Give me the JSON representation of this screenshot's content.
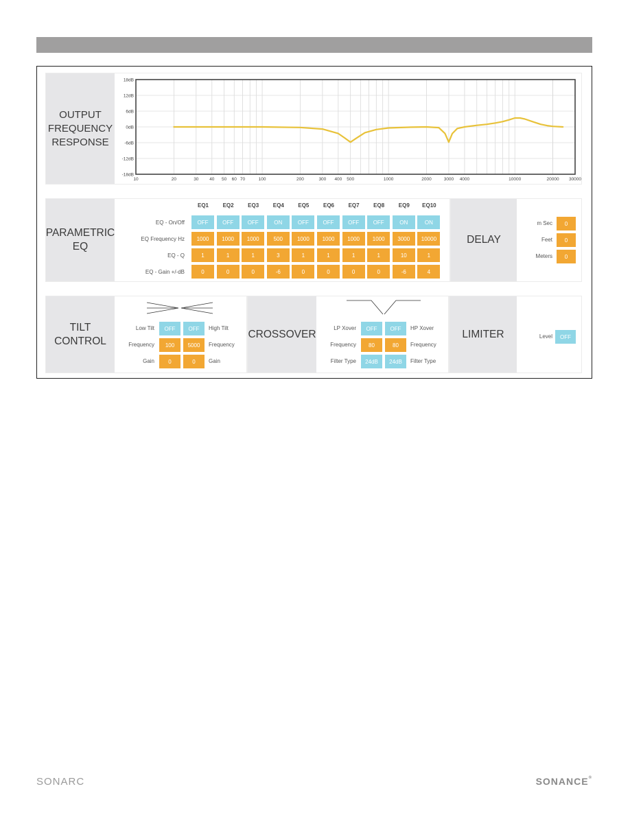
{
  "footer": {
    "left_logo": "SONARC",
    "right_logo": "SONANCE",
    "right_mark": "®"
  },
  "chart": {
    "label": [
      "OUTPUT",
      "FREQUENCY",
      "RESPONSE"
    ]
  },
  "chart_data": {
    "type": "line",
    "title": "Output Frequency Response",
    "xscale": "log",
    "xlim": [
      10,
      30000
    ],
    "ylim": [
      -18,
      18
    ],
    "x_ticks": [
      10,
      20,
      30,
      40,
      50,
      60,
      70,
      100,
      200,
      300,
      400,
      500,
      1000,
      2000,
      3000,
      4000,
      10000,
      20000,
      30000
    ],
    "x_tick_labels": [
      "10",
      "20",
      "30",
      "40",
      "50",
      "60",
      "70",
      "100",
      "200",
      "300",
      "400",
      "500",
      "1000",
      "2000",
      "3000",
      "4000",
      "10000",
      "20000",
      "30000"
    ],
    "y_ticks": [
      18,
      12,
      6,
      0,
      -6,
      -12,
      -18
    ],
    "y_tick_labels": [
      "18dB",
      "12dB",
      "6dB",
      "0dB",
      "-6dB",
      "-12dB",
      "-18dB"
    ],
    "grid": true,
    "series": [
      {
        "name": "response",
        "color": "#e8c23a",
        "x": [
          20,
          50,
          100,
          200,
          300,
          400,
          450,
          500,
          560,
          650,
          800,
          1000,
          1500,
          2000,
          2500,
          2800,
          3000,
          3200,
          3500,
          4000,
          5000,
          6000,
          7000,
          8000,
          9000,
          10000,
          11000,
          12000,
          14000,
          16000,
          18000,
          20000,
          24000
        ],
        "y": [
          0,
          0,
          0,
          -0.2,
          -0.8,
          -2.5,
          -4.2,
          -5.8,
          -4.2,
          -2.2,
          -1.0,
          -0.4,
          -0.1,
          0,
          -0.3,
          -2.5,
          -5.8,
          -2.5,
          -0.6,
          0,
          0.6,
          1.0,
          1.5,
          2.0,
          2.7,
          3.4,
          3.4,
          3.0,
          1.9,
          1.0,
          0.5,
          0.2,
          0
        ]
      }
    ]
  },
  "eq": {
    "label": [
      "PARAMETRIC",
      "EQ"
    ],
    "row_labels": [
      "EQ - On/Off",
      "EQ Frequency Hz",
      "EQ - Q",
      "EQ - Gain +/-dB"
    ],
    "bands": [
      {
        "name": "EQ1",
        "state": "OFF",
        "freq": "1000",
        "q": "1",
        "gain": "0"
      },
      {
        "name": "EQ2",
        "state": "OFF",
        "freq": "1000",
        "q": "1",
        "gain": "0"
      },
      {
        "name": "EQ3",
        "state": "OFF",
        "freq": "1000",
        "q": "1",
        "gain": "0"
      },
      {
        "name": "EQ4",
        "state": "ON",
        "freq": "500",
        "q": "3",
        "gain": "-6"
      },
      {
        "name": "EQ5",
        "state": "OFF",
        "freq": "1000",
        "q": "1",
        "gain": "0"
      },
      {
        "name": "EQ6",
        "state": "OFF",
        "freq": "1000",
        "q": "1",
        "gain": "0"
      },
      {
        "name": "EQ7",
        "state": "OFF",
        "freq": "1000",
        "q": "1",
        "gain": "0"
      },
      {
        "name": "EQ8",
        "state": "OFF",
        "freq": "1000",
        "q": "1",
        "gain": "0"
      },
      {
        "name": "EQ9",
        "state": "ON",
        "freq": "3000",
        "q": "10",
        "gain": "-6"
      },
      {
        "name": "EQ10",
        "state": "ON",
        "freq": "10000",
        "q": "1",
        "gain": "4"
      }
    ]
  },
  "delay": {
    "label": "DELAY",
    "rows": [
      {
        "label": "m Sec",
        "value": "0"
      },
      {
        "label": "Feet",
        "value": "0"
      },
      {
        "label": "Meters",
        "value": "0"
      }
    ]
  },
  "tilt": {
    "label": [
      "TILT",
      "CONTROL"
    ],
    "left": {
      "toggle_label": "Low Tilt",
      "toggle": "OFF",
      "freq_label": "Frequency",
      "freq": "100",
      "gain_label": "Gain",
      "gain": "0"
    },
    "right": {
      "toggle_label": "High Tilt",
      "toggle": "OFF",
      "freq_label": "Frequency",
      "freq": "5000",
      "gain_label": "Gain",
      "gain": "0"
    }
  },
  "crossover": {
    "label": "CROSSOVER",
    "left": {
      "toggle_label": "LP Xover",
      "toggle": "OFF",
      "freq_label": "Frequency",
      "freq": "80",
      "type_label": "Filter Type",
      "type": "24dB"
    },
    "right": {
      "toggle_label": "HP Xover",
      "toggle": "OFF",
      "freq_label": "Frequency",
      "freq": "80",
      "type_label": "Filter Type",
      "type": "24dB"
    }
  },
  "limiter": {
    "label": "LIMITER",
    "level_label": "Level",
    "level": "OFF"
  },
  "colors": {
    "on_off_cell": "#8fd6e6",
    "value_cell": "#f2a733",
    "section_label_bg": "#e6e6e8",
    "curve": "#e8c23a"
  }
}
